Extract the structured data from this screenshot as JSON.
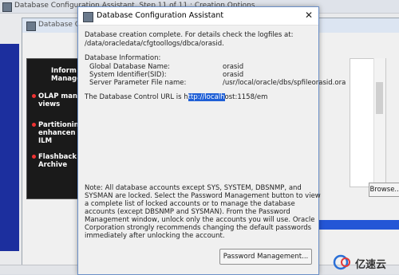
{
  "background_window": {
    "title": "Database Configuration Assistant, Step 11 of 11 : Creation Options"
  },
  "wizard_window": {
    "title": "Database Configuration Assistant, Step 11 of 11 : Creation Options",
    "features": [
      {
        "label_line1": "Inform",
        "label_line2": "Manage"
      },
      {
        "label_line1": "OLAP mana",
        "label_line2": "views"
      },
      {
        "label_line1": "Partitionin",
        "label_line2": "enhancen",
        "label_line3": "ILM"
      },
      {
        "label_line1": "Flashback",
        "label_line2": "Archive"
      }
    ],
    "browse_label": "Browse..."
  },
  "dialog": {
    "title": "Database Configuration Assistant",
    "close_glyph": "✕",
    "intro_line1": "Database creation complete. For details check the logfiles at:",
    "intro_line2": " /data/oracledata/cfgtoollogs/dbca/orasid.",
    "info_heading": "Database Information:",
    "info": [
      {
        "label": "Global Database Name:",
        "value": "orasid"
      },
      {
        "label": "System Identifier(SID):",
        "value": "orasid"
      },
      {
        "label": "Server Parameter File name:",
        "value": "/usr/local/oracle/dbs/spfileorasid.ora"
      }
    ],
    "url_prefix": "The Database Control URL is h",
    "url_selected": "ttp://localh",
    "url_suffix": "ost:1158/em",
    "note_lines": [
      "Note: All database accounts except SYS, SYSTEM, DBSNMP, and",
      "SYSMAN are locked. Select the Password Management button to view",
      "a complete list of locked accounts or to manage the database",
      "accounts (except DBSNMP and SYSMAN). From the Password",
      "Management window, unlock only the accounts you will use. Oracle",
      "Corporation strongly recommends changing the default passwords",
      "immediately after unlocking the account."
    ],
    "password_button": "Password Management..."
  },
  "watermark": {
    "text": "亿速云"
  },
  "colors": {
    "selection": "#1f5fd6",
    "feature_bullet": "#e33333",
    "left_strip": "#1c2f9e"
  }
}
